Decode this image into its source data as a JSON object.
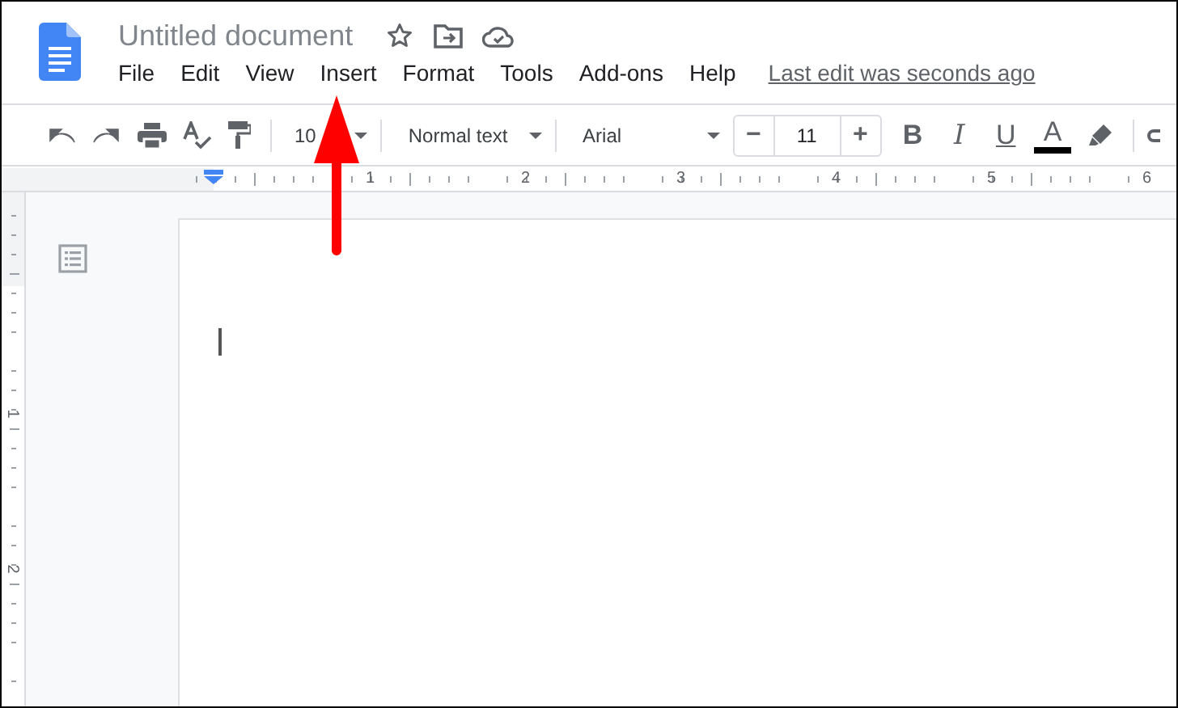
{
  "document": {
    "title": "Untitled document",
    "starred": false
  },
  "menu": [
    "File",
    "Edit",
    "View",
    "Insert",
    "Format",
    "Tools",
    "Add-ons",
    "Help"
  ],
  "last_edit": "Last edit was seconds ago",
  "toolbar": {
    "zoom": "10",
    "style": "Normal text",
    "font": "Arial",
    "font_size": "11",
    "minus": "−",
    "plus": "+",
    "bold": "B",
    "italic": "I",
    "underline": "U",
    "text_color_label": "A"
  },
  "ruler": {
    "horizontal": [
      "1",
      "2",
      "3",
      "4",
      "5",
      "6"
    ],
    "vertical": [
      "1",
      "2"
    ]
  }
}
